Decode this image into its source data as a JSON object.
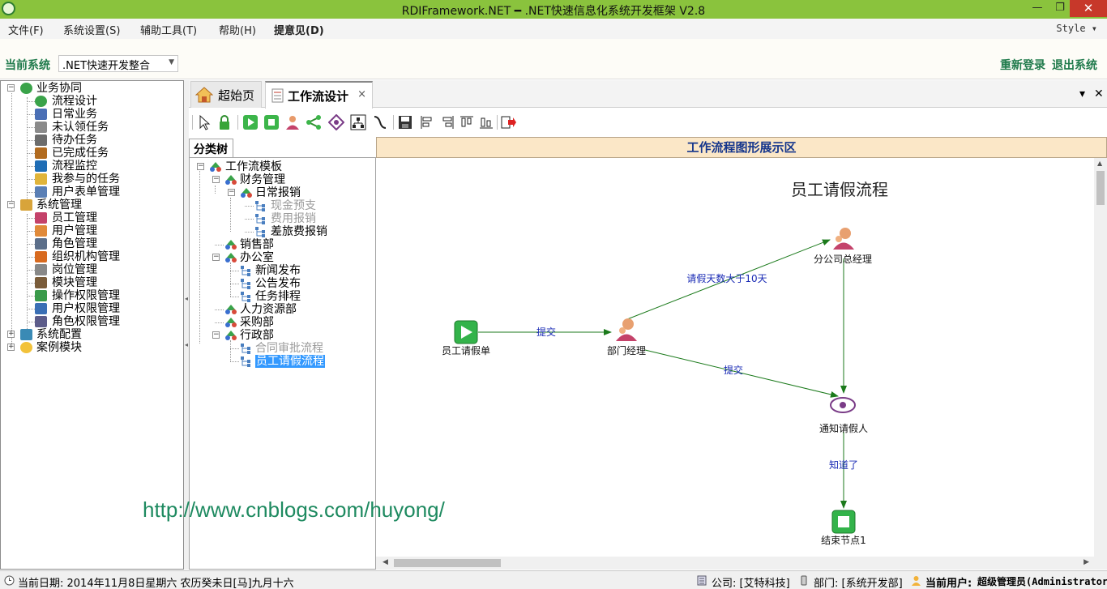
{
  "window": {
    "title": "RDIFramework.NET ━ .NET快速信息化系统开发框架 V2.8",
    "minimize_glyph": "—",
    "maximize_glyph": "❐",
    "close_glyph": "✕"
  },
  "menu": {
    "items": [
      "文件(F)",
      "系统设置(S)",
      "辅助工具(T)",
      "帮助(H)",
      "提意见(D)"
    ],
    "style_label": "Style ▾"
  },
  "system_bar": {
    "label": "当前系统",
    "selected_system": ".NET快速开发整合",
    "relogin": "重新登录",
    "exit": "退出系统"
  },
  "nav_tree": [
    {
      "label": "业务协同",
      "icon": "group-icon",
      "level": 0,
      "expanded": true
    },
    {
      "label": "流程设计",
      "icon": "flow-design-icon",
      "level": 1
    },
    {
      "label": "日常业务",
      "icon": "daily-icon",
      "level": 1
    },
    {
      "label": "未认领任务",
      "icon": "unclaimed-task-icon",
      "level": 1
    },
    {
      "label": "待办任务",
      "icon": "todo-task-icon",
      "level": 1
    },
    {
      "label": "已完成任务",
      "icon": "done-task-icon",
      "level": 1
    },
    {
      "label": "流程监控",
      "icon": "monitor-eye-icon",
      "level": 1
    },
    {
      "label": "我参与的任务",
      "icon": "participated-task-icon",
      "level": 1
    },
    {
      "label": "用户表单管理",
      "icon": "form-icon",
      "level": 1
    },
    {
      "label": "系统管理",
      "icon": "system-folder-icon",
      "level": 0,
      "expanded": true
    },
    {
      "label": "员工管理",
      "icon": "staff-icon",
      "level": 1
    },
    {
      "label": "用户管理",
      "icon": "user-icon",
      "level": 1
    },
    {
      "label": "角色管理",
      "icon": "role-icon",
      "level": 1
    },
    {
      "label": "组织机构管理",
      "icon": "org-icon",
      "level": 1
    },
    {
      "label": "岗位管理",
      "icon": "post-icon",
      "level": 1
    },
    {
      "label": "模块管理",
      "icon": "module-icon",
      "level": 1
    },
    {
      "label": "操作权限管理",
      "icon": "permission-icon",
      "level": 1
    },
    {
      "label": "用户权限管理",
      "icon": "user-permission-icon",
      "level": 1
    },
    {
      "label": "角色权限管理",
      "icon": "role-permission-icon",
      "level": 1
    },
    {
      "label": "系统配置",
      "icon": "config-icon",
      "level": 0,
      "expanded": false
    },
    {
      "label": "案例模块",
      "icon": "bulb-icon",
      "level": 0,
      "expanded": false
    }
  ],
  "tabs": [
    {
      "label": "超始页",
      "icon": "home-icon"
    },
    {
      "label": "工作流设计",
      "icon": "form-icon",
      "active": true,
      "close_glyph": "×"
    }
  ],
  "tab_controls": {
    "dropdown_glyph": "▾",
    "close_glyph": "✕"
  },
  "toolbar_icons": [
    "pointer-icon",
    "lock-icon",
    "start-node-icon",
    "end-node-icon",
    "task-node-icon",
    "branch-icon",
    "notify-node-icon",
    "org-node-icon",
    "line-icon",
    "save-icon",
    "align-left-icon",
    "align-right-icon",
    "align-top-icon",
    "align-bottom-icon",
    "export-icon"
  ],
  "category": {
    "tab_label": "分类树",
    "tree": [
      {
        "label": "工作流模板",
        "level": 0
      },
      {
        "label": "财务管理",
        "level": 1
      },
      {
        "label": "日常报销",
        "level": 2
      },
      {
        "label": "现金预支",
        "level": 3,
        "disabled": true
      },
      {
        "label": "费用报销",
        "level": 3,
        "disabled": true
      },
      {
        "label": "差旅费报销",
        "level": 3
      },
      {
        "label": "销售部",
        "level": 1
      },
      {
        "label": "办公室",
        "level": 1
      },
      {
        "label": "新闻发布",
        "level": 2
      },
      {
        "label": "公告发布",
        "level": 2
      },
      {
        "label": "任务排程",
        "level": 2
      },
      {
        "label": "人力资源部",
        "level": 1
      },
      {
        "label": "采购部",
        "level": 1
      },
      {
        "label": "行政部",
        "level": 1
      },
      {
        "label": "合同审批流程",
        "level": 2,
        "disabled": true
      },
      {
        "label": "员工请假流程",
        "level": 2,
        "selected": true
      }
    ]
  },
  "flow": {
    "header": "工作流程图形展示区",
    "title": "员工请假流程",
    "nodes": [
      {
        "id": "start",
        "label": "员工请假单",
        "type": "start"
      },
      {
        "id": "dept",
        "label": "部门经理",
        "type": "person"
      },
      {
        "id": "gm",
        "label": "分公司总经理",
        "type": "person"
      },
      {
        "id": "notify",
        "label": "通知请假人",
        "type": "notify"
      },
      {
        "id": "end",
        "label": "结束节点1",
        "type": "end"
      }
    ],
    "edges": [
      {
        "from": "start",
        "to": "dept",
        "label": "提交"
      },
      {
        "from": "dept",
        "to": "gm",
        "label": "请假天数大于10天"
      },
      {
        "from": "dept",
        "to": "notify",
        "label": "提交"
      },
      {
        "from": "gm",
        "to": "notify",
        "label": ""
      },
      {
        "from": "notify",
        "to": "end",
        "label": "知道了"
      }
    ],
    "colors": {
      "edge": "#1b7a1b",
      "edge_label": "#1a2bb5",
      "node_green": "#33b34a",
      "notify_purple": "#7a3c87"
    }
  },
  "watermark": "http://www.cnblogs.com/huyong/",
  "status": {
    "date": "当前日期: 2014年11月8日星期六  农历癸未日[马]九月十六",
    "company": "公司: [艾特科技]",
    "department": "部门: [系统开发部]",
    "user_label": "当前用户:",
    "user_value": "超级管理员(Administrator)"
  }
}
